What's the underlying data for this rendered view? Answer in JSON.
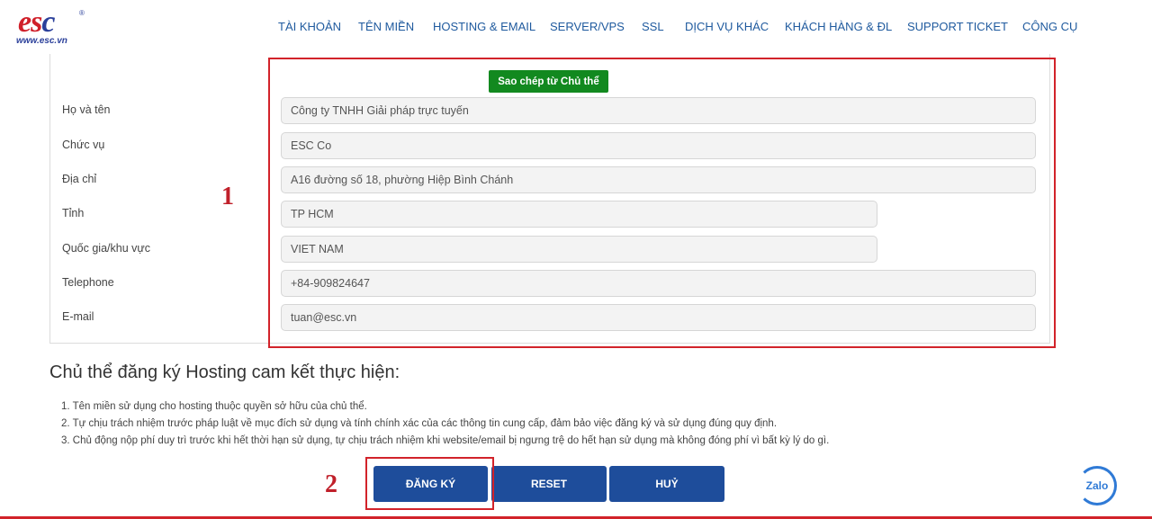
{
  "logo": {
    "word_a": "es",
    "word_b": "c",
    "url": "www.esc.vn",
    "reg": "®"
  },
  "nav": [
    {
      "label": "TÀI KHOẢN"
    },
    {
      "label": "TÊN MIỀN"
    },
    {
      "label": "HOSTING & EMAIL"
    },
    {
      "label": "SERVER/VPS"
    },
    {
      "label": "SSL"
    },
    {
      "label": "DỊCH VỤ KHÁC"
    },
    {
      "label": "KHÁCH HÀNG & ĐL"
    },
    {
      "label": "SUPPORT TICKET"
    },
    {
      "label": "CÔNG CỤ"
    }
  ],
  "form": {
    "copy_button": "Sao chép từ Chủ thể",
    "rows": [
      {
        "label": "Họ và tên",
        "value": "Công ty TNHH Giải pháp trực tuyến"
      },
      {
        "label": "Chức vụ",
        "value": "ESC Co"
      },
      {
        "label": "Địa chỉ",
        "value": "A16 đường số 18, phường Hiệp Bình Chánh"
      },
      {
        "label": "Tỉnh",
        "value": "TP HCM"
      },
      {
        "label": "Quốc gia/khu vực",
        "value": "VIET NAM"
      },
      {
        "label": "Telephone",
        "value": "+84-909824647"
      },
      {
        "label": "E-mail",
        "value": "tuan@esc.vn"
      }
    ]
  },
  "annotations": {
    "one": "1",
    "two": "2"
  },
  "commitment": {
    "title": "Chủ thể đăng ký Hosting cam kết thực hiện:",
    "items": [
      "1. Tên miền sử dụng cho hosting thuộc quyền sở hữu của chủ thể.",
      "2. Tự chịu trách nhiệm trước pháp luật về mục đích sử dụng và tính chính xác của các thông tin cung cấp, đảm bảo việc đăng ký và sử dụng đúng quy định.",
      "3. Chủ động nộp phí duy trì trước khi hết thời hạn sử dụng, tự chịu trách nhiệm khi website/email bị ngưng trệ do hết hạn sử dụng mà không đóng phí vì bất kỳ lý do gì."
    ]
  },
  "buttons": {
    "register": "ĐĂNG KÝ",
    "reset": "RESET",
    "cancel": "HUỶ"
  },
  "zalo": {
    "label": "Zalo"
  },
  "colors": {
    "nav": "#1f5a9e",
    "primary_button": "#1e4d9b",
    "copy_button": "#12891f",
    "annotation": "#d2232a"
  }
}
